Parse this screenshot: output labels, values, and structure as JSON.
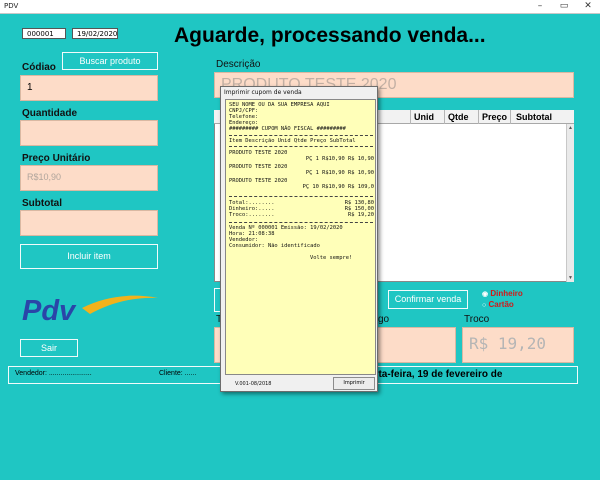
{
  "window": {
    "title": "PDV",
    "minimize": "–",
    "maximize": "▭",
    "close": "✕"
  },
  "header": {
    "sale_number": "000001",
    "date": "19/02/2020",
    "heading": "Aguarde, processando venda..."
  },
  "left": {
    "codigo_label": "Códiao",
    "buscar_label": "Buscar produto",
    "codigo_value": "1",
    "quantidade_label": "Quantidade",
    "preco_label": "Preço Unitário",
    "preco_value": "R$10,90",
    "subtotal_label": "Subtotal",
    "incluir_label": "Incluir item",
    "logo_text": "Pdv",
    "sair_label": "Sair"
  },
  "main": {
    "descricao_label": "Descrição",
    "descricao_value": "PRODUTO TESTE 2020",
    "columns": [
      "Unid",
      "Qtde",
      "Preço",
      "Subtotal"
    ],
    "confirmar_label": "Confirmar venda",
    "payment_options": [
      "Dinheiro",
      "Cartão"
    ],
    "total_label_partial": "T",
    "dinheiro_label_partial": "go",
    "troco_label": "Troco",
    "troco_value": "R$ 19,20"
  },
  "status": {
    "vendedor": "Vendedor: ......................",
    "cliente": "Cliente: ......",
    "date_text": "arta-feira, 19 de fevereiro de"
  },
  "dialog": {
    "title": "Imprimir cupom de venda",
    "receipt": {
      "header_lines": [
        "SEU NOME OU DA SUA EMPRESA AQUI",
        "CNPJ/CPF:",
        "Telefone:",
        "Endereço:",
        "######### CUPOM NÃO FISCAL #########"
      ],
      "columns_line": "Item Descrição Unid Qtde Preço SubTotal",
      "items": [
        {
          "desc": "PRODUTO TESTE 2020",
          "line": "PÇ 1 R$10,90 R$ 10,90"
        },
        {
          "desc": "PRODUTO TESTE 2020",
          "line": "PÇ 1 R$10,90 R$ 10,90"
        },
        {
          "desc": "PRODUTO TESTE 2020",
          "line": "PÇ 10 R$10,90 R$ 109,0"
        }
      ],
      "totals": [
        {
          "label": "Total:........",
          "value": "R$ 130,80"
        },
        {
          "label": "Dinheiro:.....",
          "value": "R$ 150,00"
        },
        {
          "label": "Troco:........",
          "value": "R$ 19,20"
        }
      ],
      "footer_lines": [
        "Venda Nº 000001 Emissão: 19/02/2020",
        "Hora: 21:08:38",
        "Vendedor:",
        "Consumidor: Não identificado"
      ],
      "closing": "Volte sempre!"
    },
    "version": "V.001-08/2018",
    "print_label": "Imprimir"
  }
}
